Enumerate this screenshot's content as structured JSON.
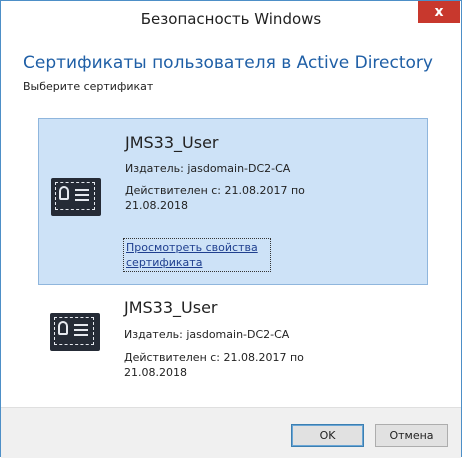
{
  "window": {
    "title": "Безопасность Windows",
    "close_label": "x"
  },
  "header": {
    "heading": "Сертификаты пользователя в Active Directory",
    "subheading": "Выберите сертификат"
  },
  "certificates": [
    {
      "name": "JMS33_User",
      "issuer": "Издатель: jasdomain-DC2-CA",
      "validity": "Действителен с: 21.08.2017 по 21.08.2018",
      "link": "Просмотреть свойства сертификата",
      "selected": true,
      "icon": "certificate-icon"
    },
    {
      "name": "JMS33_User",
      "issuer": "Издатель: jasdomain-DC2-CA",
      "validity": "Действителен с: 21.08.2017 по 21.08.2018",
      "selected": false,
      "icon": "certificate-icon"
    }
  ],
  "buttons": {
    "ok": "OK",
    "cancel": "Отмена"
  },
  "colors": {
    "accent": "#1f5fa6",
    "selection": "#cde2f7",
    "close": "#c8382d"
  }
}
